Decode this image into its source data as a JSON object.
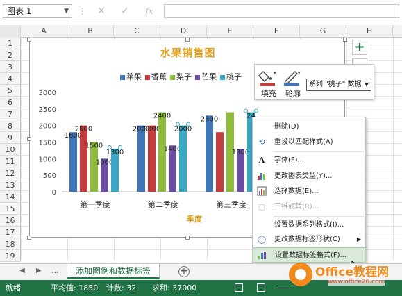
{
  "formula_bar": {
    "name_box": "图表 1",
    "fx_label": "fx"
  },
  "columns": [
    "A",
    "B",
    "C",
    "D",
    "E",
    "F",
    "G",
    "H"
  ],
  "rows": [
    "1",
    "2",
    "3",
    "4",
    "5",
    "6",
    "7",
    "8",
    "9",
    "10",
    "11",
    "12",
    "13",
    "14",
    "15",
    "16",
    "17",
    "18",
    "19"
  ],
  "chart_data": {
    "type": "bar",
    "title": "水果销售图",
    "xlabel": "季度",
    "ylabel": "",
    "categories": [
      "第一季度",
      "第二季度",
      "第三季度"
    ],
    "ylim": [
      0,
      3000
    ],
    "yticks": [
      "0",
      "500",
      "1000",
      "1500",
      "2000",
      "2500",
      "3000"
    ],
    "legend_position": "top",
    "series": [
      {
        "name": "苹果",
        "values": [
          1800,
          2000,
          2300
        ],
        "color": "#3e74b8",
        "labels": [
          "1800",
          "2000",
          "2300"
        ]
      },
      {
        "name": "香蕉",
        "values": [
          2000,
          2000,
          1800
        ],
        "color": "#c43c3c",
        "labels": [
          "2000",
          "2000",
          ""
        ]
      },
      {
        "name": "梨子",
        "values": [
          1500,
          2400,
          2400
        ],
        "color": "#8fbc3f",
        "labels": [
          "1500",
          "2400",
          ""
        ]
      },
      {
        "name": "芒果",
        "values": [
          1000,
          1400,
          1300
        ],
        "color": "#6a4ea0",
        "labels": [
          "1000",
          "1400",
          "1300"
        ]
      },
      {
        "name": "桃子",
        "values": [
          1300,
          2000,
          2400
        ],
        "color": "#3aa7c2",
        "labels": [
          "1300",
          "2000",
          "24"
        ]
      }
    ]
  },
  "mini_toolbar": {
    "fill_label": "填充",
    "outline_label": "轮廓",
    "series_selector": "系列 \"桃子\" 数据"
  },
  "context_menu": {
    "items": [
      {
        "label": "删除(D)",
        "icon": "delete-icon",
        "enabled": true
      },
      {
        "label": "重设以匹配样式(A)",
        "icon": "reset-style-icon",
        "enabled": true
      },
      {
        "label": "字体(F)...",
        "icon": "font-icon",
        "enabled": true
      },
      {
        "label": "更改图表类型(Y)...",
        "icon": "chart-type-icon",
        "enabled": true
      },
      {
        "label": "选择数据(E)...",
        "icon": "select-data-icon",
        "enabled": true
      },
      {
        "label": "三维旋转(R)...",
        "icon": "rotate-3d-icon",
        "enabled": false
      },
      {
        "label": "设置数据系列格式(I)...",
        "icon": "",
        "enabled": true
      },
      {
        "label": "更改数据标签形状(C)",
        "icon": "label-shape-icon",
        "enabled": true,
        "submenu": true
      },
      {
        "label": "设置数据标签格式(F)...",
        "icon": "format-label-icon",
        "enabled": true,
        "highlighted": true
      }
    ]
  },
  "sheet_tabs": {
    "ellipsis": "...",
    "active_tab": "添加图例和数据标签",
    "add_label": "+"
  },
  "status_bar": {
    "ready": "就绪",
    "average": "平均值: 1850",
    "count": "计数: 32",
    "sum": "求和: 37000"
  },
  "watermark": {
    "text": "Office教程网",
    "url": "www.office26.com"
  },
  "colors": {
    "excel_green": "#217346",
    "title_gold": "#e0a020"
  }
}
